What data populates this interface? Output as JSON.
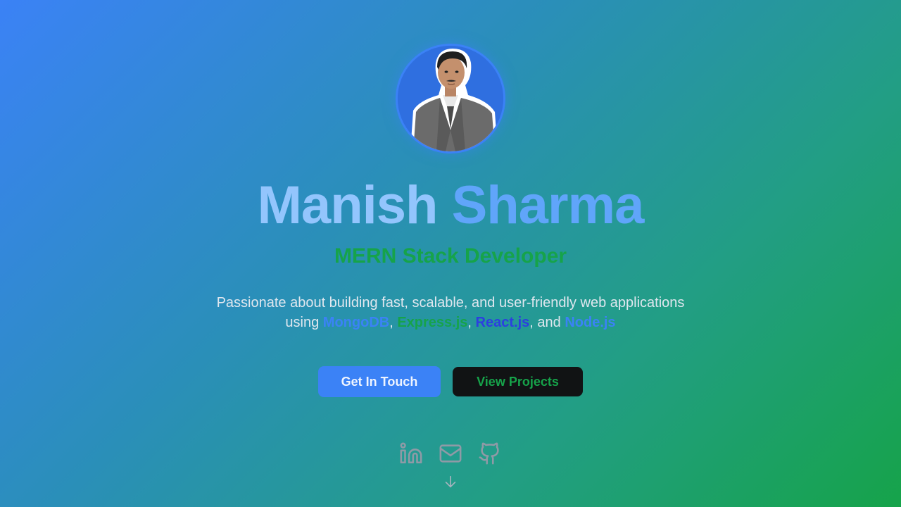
{
  "profile": {
    "name_first": "Manish",
    "name_last": "Sharma",
    "role": "MERN Stack Developer",
    "avatar_icon": "portrait-photo"
  },
  "description": {
    "line1": "Passionate about building fast, scalable, and user-friendly web applications",
    "using": "using ",
    "tech1": "MongoDB",
    "sep1": ", ",
    "tech2": "Express.js",
    "sep2": ", ",
    "tech3": "React.js",
    "sep3": ", and ",
    "tech4": "Node.js"
  },
  "buttons": {
    "primary_label": "Get In Touch",
    "secondary_label": "View Projects"
  },
  "socials": [
    {
      "icon": "linkedin-icon"
    },
    {
      "icon": "mail-icon"
    },
    {
      "icon": "github-icon"
    }
  ],
  "scroll_icon": "arrow-down-icon",
  "colors": {
    "accent_blue": "#3b82f6",
    "accent_green": "#16a34a",
    "dark_button": "#111314"
  }
}
